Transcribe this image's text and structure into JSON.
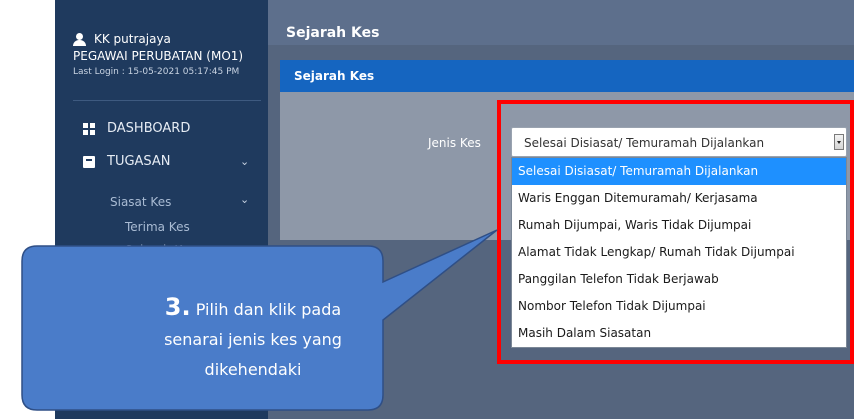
{
  "sidebar": {
    "user_name": "KK putrajaya",
    "user_role": "PEGAWAI PERUBATAN (MO1)",
    "last_login": "Last Login : 15-05-2021 05:17:45 PM",
    "nav": {
      "dashboard": "DASHBOARD",
      "tugasan": "TUGASAN",
      "siasat_kes": "Siasat Kes",
      "terima_kes": "Terima Kes",
      "sejarah_kes": "Sejarah Kes"
    }
  },
  "header": {
    "title": "Sejarah Kes"
  },
  "panel": {
    "title": "Sejarah Kes",
    "field_label": "Jenis Kes",
    "selected_value": "Selesai Disiasat/ Temuramah Dijalankan",
    "options": [
      "Selesai Disiasat/ Temuramah Dijalankan",
      "Waris Enggan Ditemuramah/ Kerjasama",
      "Rumah Dijumpai, Waris Tidak Dijumpai",
      "Alamat Tidak Lengkap/ Rumah Tidak Dijumpai",
      "Panggilan Telefon Tidak Berjawab",
      "Nombor Telefon Tidak Dijumpai",
      "Masih Dalam Siasatan"
    ]
  },
  "callout": {
    "step": "3.",
    "line1": "Pilih dan klik pada",
    "line2": "senarai jenis kes yang",
    "line3": "dikehendaki"
  },
  "colors": {
    "sidebar": "#1f3a5e",
    "panel_header": "#1565c0",
    "selected_option": "#1e90ff",
    "highlight": "#ff0000",
    "callout_fill": "#4a7cc9"
  }
}
